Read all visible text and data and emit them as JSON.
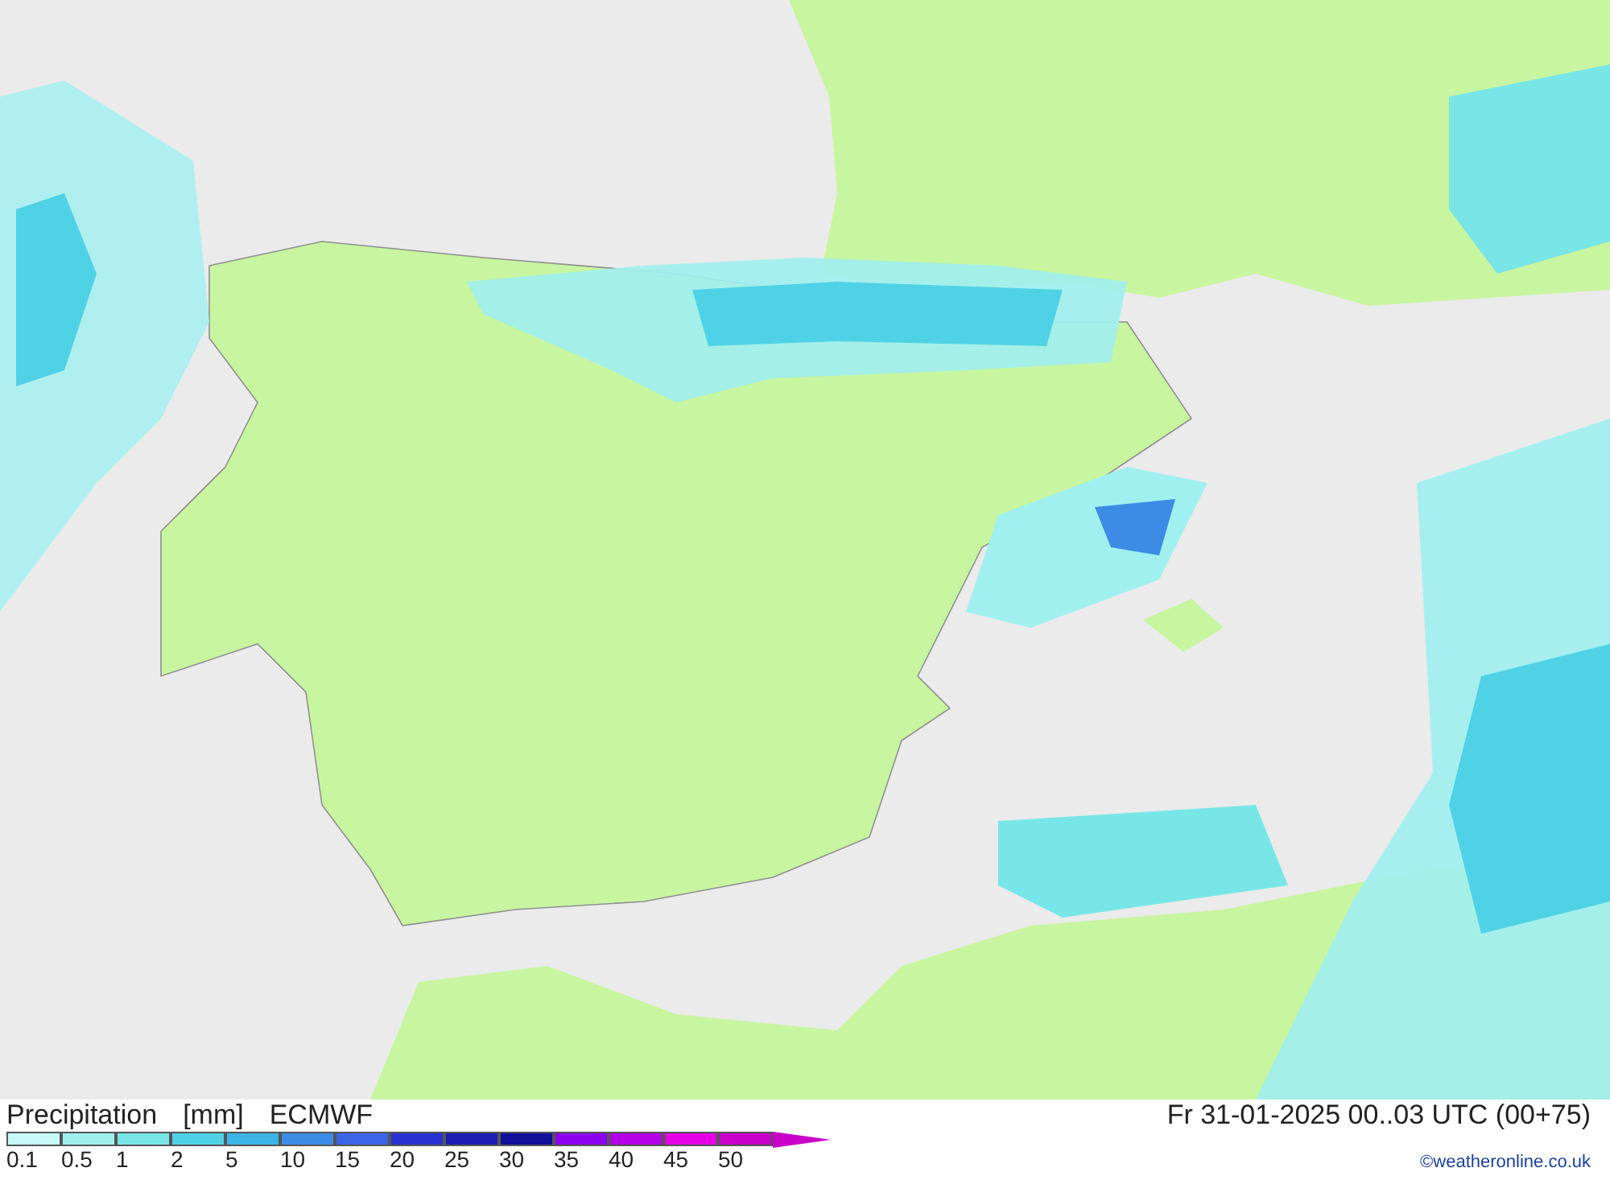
{
  "map": {
    "title": [
      "Precipitation",
      "[mm]",
      "ECMWF"
    ],
    "valid_time": "Fr 31-01-2025 00..03 UTC (00+75)"
  },
  "legend": [
    {
      "label": "0.1",
      "color": "#c8fafa"
    },
    {
      "label": "0.5",
      "color": "#a0f0f0"
    },
    {
      "label": "1",
      "color": "#78e6e6"
    },
    {
      "label": "2",
      "color": "#50d2e6"
    },
    {
      "label": "5",
      "color": "#3cb4e6"
    },
    {
      "label": "10",
      "color": "#3c8ce6"
    },
    {
      "label": "15",
      "color": "#3c64e6"
    },
    {
      "label": "20",
      "color": "#2832d2"
    },
    {
      "label": "25",
      "color": "#1e1eb4"
    },
    {
      "label": "30",
      "color": "#10109a"
    },
    {
      "label": "35",
      "color": "#8c00f0"
    },
    {
      "label": "40",
      "color": "#b400e6"
    },
    {
      "label": "45",
      "color": "#e600e6"
    },
    {
      "label": "50",
      "color": "#c800c8"
    }
  ],
  "credit": "©weatheronline.co.uk"
}
